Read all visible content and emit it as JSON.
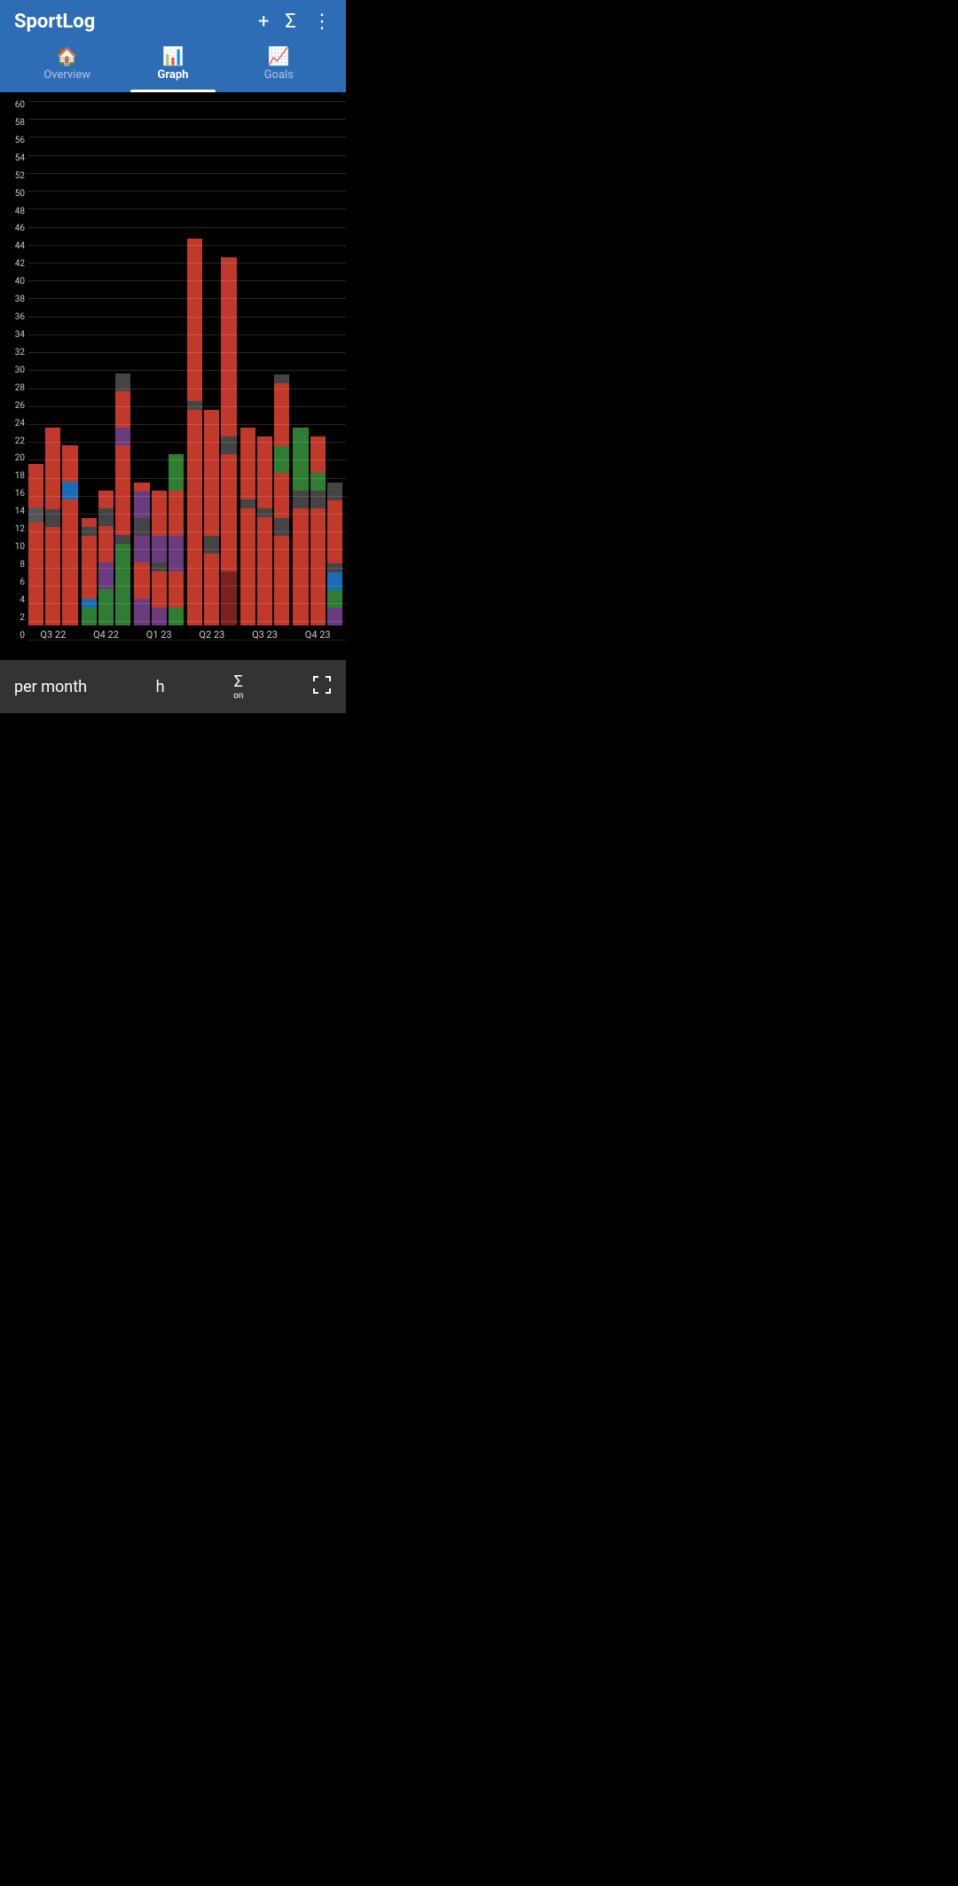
{
  "app": {
    "title": "SportLog",
    "header_icons": {
      "add": "+",
      "sigma": "Σ",
      "more": "⋮"
    }
  },
  "nav": {
    "tabs": [
      {
        "id": "overview",
        "label": "Overview",
        "icon": "🏠",
        "active": false
      },
      {
        "id": "graph",
        "label": "Graph",
        "icon": "📊",
        "active": true
      },
      {
        "id": "goals",
        "label": "Goals",
        "icon": "📈",
        "active": false
      }
    ]
  },
  "chart": {
    "y_labels": [
      "0",
      "2",
      "4",
      "6",
      "8",
      "10",
      "12",
      "14",
      "16",
      "18",
      "20",
      "22",
      "24",
      "26",
      "28",
      "30",
      "32",
      "34",
      "36",
      "38",
      "40",
      "42",
      "44",
      "46",
      "48",
      "50",
      "52",
      "54",
      "56",
      "58",
      "60"
    ],
    "max_value": 60,
    "quarters": [
      {
        "label": "Q3 22",
        "bars": [
          {
            "segments": [
              {
                "color": "#c0392b",
                "value": 14
              },
              {
                "color": "#555",
                "value": 2
              },
              {
                "color": "#c0392b",
                "value": 3
              },
              {
                "color": "#c0392b",
                "value": 3
              }
            ],
            "total": 18
          },
          {
            "segments": [
              {
                "color": "#c0392b",
                "value": 11
              },
              {
                "color": "#444",
                "value": 2
              },
              {
                "color": "#c0392b",
                "value": 4
              },
              {
                "color": "#c0392b",
                "value": 5
              }
            ],
            "total": 22
          },
          {
            "segments": [
              {
                "color": "#c0392b",
                "value": 14
              },
              {
                "color": "#1a6bb5",
                "value": 2
              },
              {
                "color": "#c0392b",
                "value": 4
              }
            ],
            "total": 20
          }
        ]
      },
      {
        "label": "Q4 22",
        "bars": [
          {
            "segments": [
              {
                "color": "#2e7d32",
                "value": 2
              },
              {
                "color": "#1a6bb5",
                "value": 1
              },
              {
                "color": "#c0392b",
                "value": 7
              },
              {
                "color": "#444",
                "value": 1
              },
              {
                "color": "#c0392b",
                "value": 1
              }
            ],
            "total": 12
          },
          {
            "segments": [
              {
                "color": "#2e7d32",
                "value": 4
              },
              {
                "color": "#6a3b7e",
                "value": 3
              },
              {
                "color": "#c0392b",
                "value": 4
              },
              {
                "color": "#444",
                "value": 2
              },
              {
                "color": "#c0392b",
                "value": 2
              }
            ],
            "total": 16
          },
          {
            "segments": [
              {
                "color": "#2e7d32",
                "value": 5
              },
              {
                "color": "#2e7d32",
                "value": 4
              },
              {
                "color": "#444",
                "value": 1
              },
              {
                "color": "#c0392b",
                "value": 10
              },
              {
                "color": "#6a3b7e",
                "value": 2
              },
              {
                "color": "#c0392b",
                "value": 4
              },
              {
                "color": "#444",
                "value": 2
              }
            ],
            "total": 28
          }
        ]
      },
      {
        "label": "Q1 23",
        "bars": [
          {
            "segments": [
              {
                "color": "#6a3b7e",
                "value": 3
              },
              {
                "color": "#c0392b",
                "value": 4
              },
              {
                "color": "#6a3b7e",
                "value": 3
              },
              {
                "color": "#444",
                "value": 2
              },
              {
                "color": "#6a3b7e",
                "value": 3
              },
              {
                "color": "#c0392b",
                "value": 1
              }
            ],
            "total": 16
          },
          {
            "segments": [
              {
                "color": "#6a3b7e",
                "value": 2
              },
              {
                "color": "#c0392b",
                "value": 4
              },
              {
                "color": "#444",
                "value": 1
              },
              {
                "color": "#6a3b7e",
                "value": 3
              },
              {
                "color": "#c0392b",
                "value": 5
              }
            ],
            "total": 15
          },
          {
            "segments": [
              {
                "color": "#2e7d32",
                "value": 2
              },
              {
                "color": "#c0392b",
                "value": 4
              },
              {
                "color": "#6a3b7e",
                "value": 4
              },
              {
                "color": "#c0392b",
                "value": 5
              },
              {
                "color": "#2e7d32",
                "value": 4
              }
            ],
            "total": 19
          }
        ]
      },
      {
        "label": "Q2 23",
        "bars": [
          {
            "segments": [
              {
                "color": "#c0392b",
                "value": 24
              },
              {
                "color": "#444",
                "value": 1
              },
              {
                "color": "#c0392b",
                "value": 18
              }
            ],
            "total": 43
          },
          {
            "segments": [
              {
                "color": "#c0392b",
                "value": 8
              },
              {
                "color": "#444",
                "value": 2
              },
              {
                "color": "#c0392b",
                "value": 14
              }
            ],
            "total": 24
          },
          {
            "segments": [
              {
                "color": "#7b1f1f",
                "value": 6
              },
              {
                "color": "#c0392b",
                "value": 13
              },
              {
                "color": "#444",
                "value": 2
              },
              {
                "color": "#c0392b",
                "value": 20
              }
            ],
            "total": 41
          }
        ]
      },
      {
        "label": "Q3 23",
        "bars": [
          {
            "segments": [
              {
                "color": "#c0392b",
                "value": 13
              },
              {
                "color": "#444",
                "value": 1
              },
              {
                "color": "#c0392b",
                "value": 8
              }
            ],
            "total": 22
          },
          {
            "segments": [
              {
                "color": "#c0392b",
                "value": 12
              },
              {
                "color": "#444",
                "value": 1
              },
              {
                "color": "#c0392b",
                "value": 8
              }
            ],
            "total": 21
          },
          {
            "segments": [
              {
                "color": "#c0392b",
                "value": 10
              },
              {
                "color": "#444",
                "value": 2
              },
              {
                "color": "#c0392b",
                "value": 5
              },
              {
                "color": "#2e7d32",
                "value": 3
              },
              {
                "color": "#c0392b",
                "value": 7
              },
              {
                "color": "#444",
                "value": 1
              }
            ],
            "total": 29
          }
        ]
      },
      {
        "label": "Q4 23",
        "bars": [
          {
            "segments": [
              {
                "color": "#c0392b",
                "value": 13
              },
              {
                "color": "#444",
                "value": 2
              },
              {
                "color": "#2e7d32",
                "value": 7
              }
            ],
            "total": 22
          },
          {
            "segments": [
              {
                "color": "#c0392b",
                "value": 13
              },
              {
                "color": "#444",
                "value": 2
              },
              {
                "color": "#2e7d32",
                "value": 2
              },
              {
                "color": "#c0392b",
                "value": 4
              }
            ],
            "total": 21
          },
          {
            "segments": [
              {
                "color": "#6a3b7e",
                "value": 2
              },
              {
                "color": "#2e7d32",
                "value": 2
              },
              {
                "color": "#1a6bb5",
                "value": 2
              },
              {
                "color": "#444",
                "value": 1
              },
              {
                "color": "#c0392b",
                "value": 4
              },
              {
                "color": "#c0392b",
                "value": 3
              },
              {
                "color": "#444",
                "value": 2
              }
            ],
            "total": 16
          }
        ]
      }
    ]
  },
  "bottom_bar": {
    "period_label": "per month",
    "unit_label": "h",
    "sigma_label": "Σ",
    "sigma_sub": "on",
    "fullscreen_label": "⛶"
  }
}
